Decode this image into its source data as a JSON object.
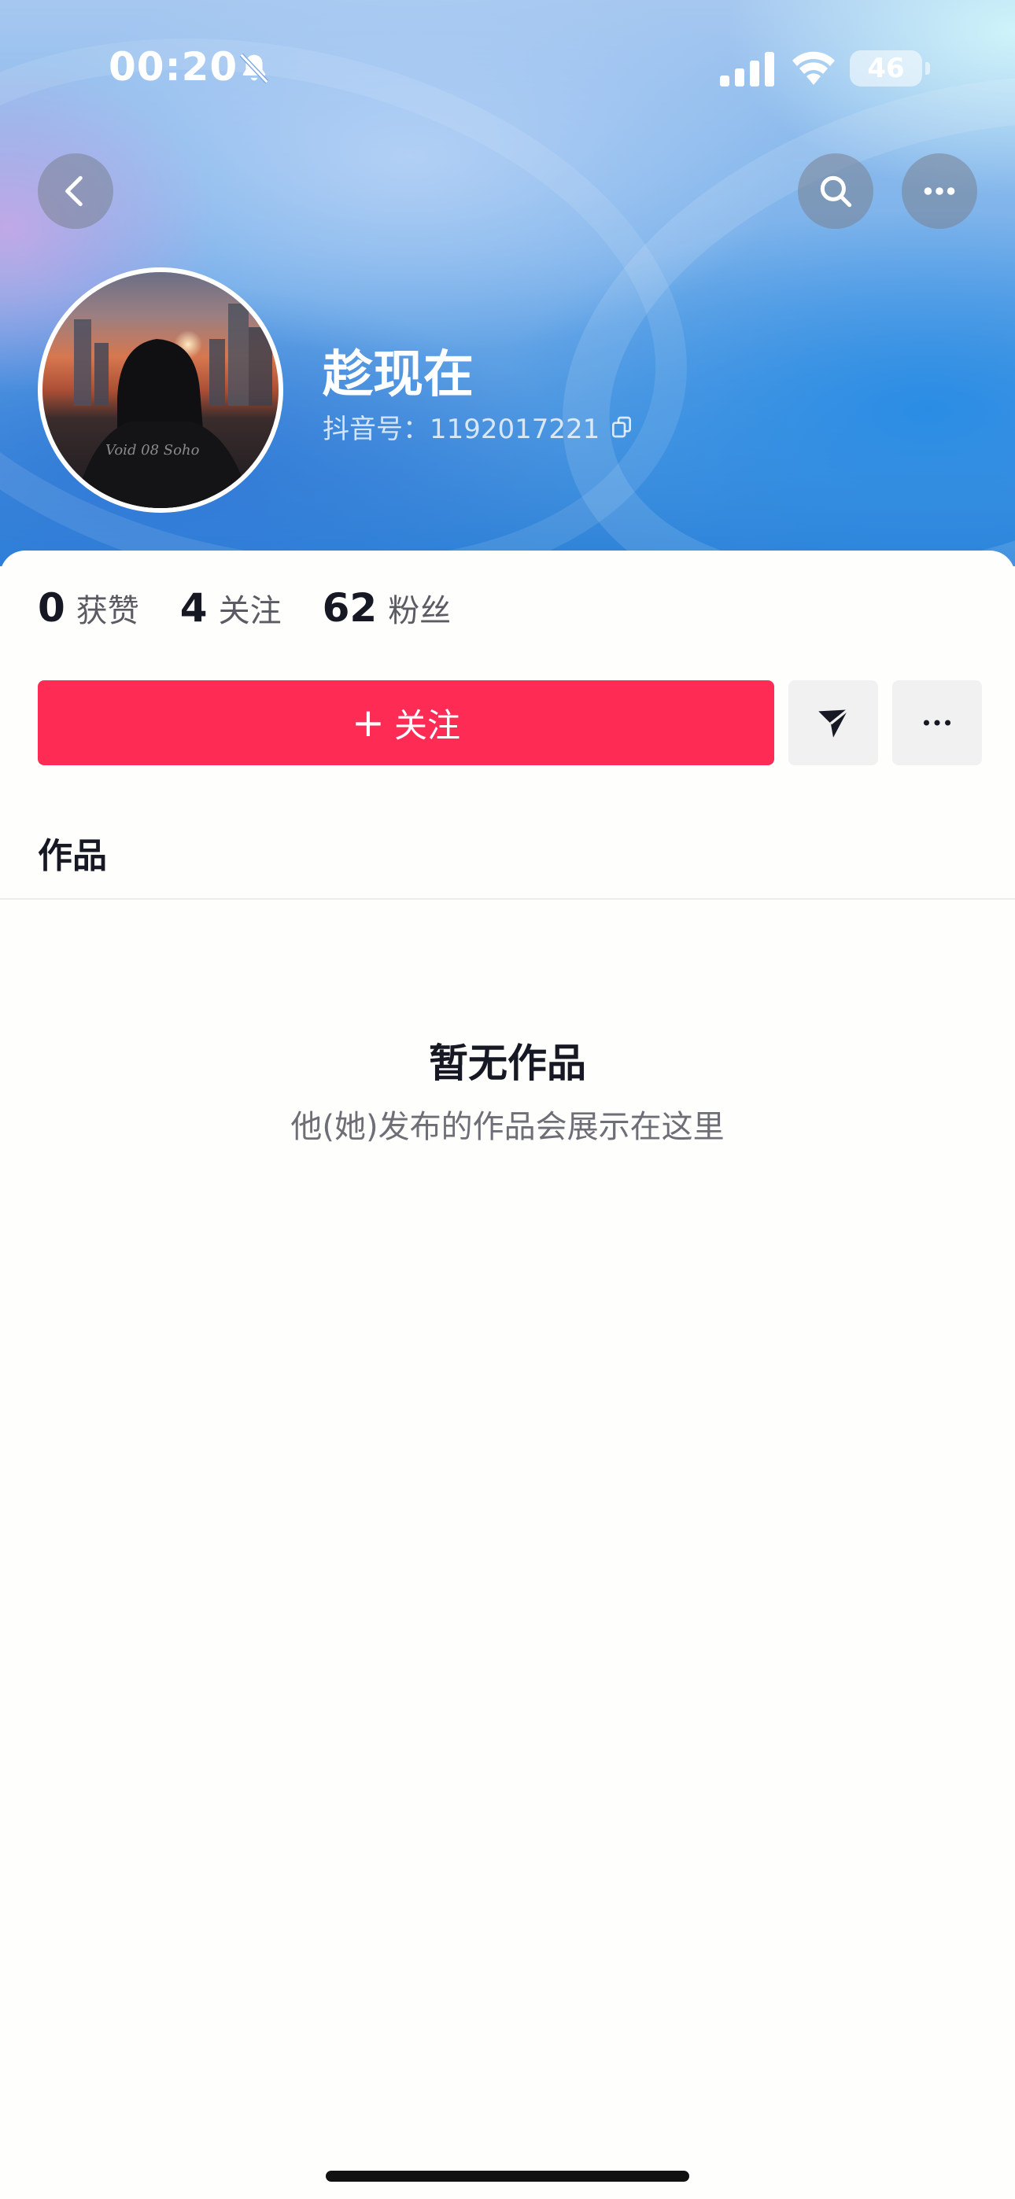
{
  "status_bar": {
    "time": "00:20",
    "battery": "46",
    "icons": [
      "bell-off-icon",
      "signal-icon",
      "wifi-icon",
      "battery-icon"
    ]
  },
  "header": {
    "icons": [
      "back-icon",
      "search-icon",
      "more-icon"
    ]
  },
  "profile": {
    "name": "趁现在",
    "douyin_id": "抖音号：1192017221"
  },
  "stats": [
    {
      "value": "0",
      "label": "获赞"
    },
    {
      "value": "4",
      "label": "关注"
    },
    {
      "value": "62",
      "label": "粉丝"
    }
  ],
  "actions": {
    "follow_label": "关注",
    "follow_icon": "+",
    "message_icon": "send-icon",
    "more_icon": "more-icon"
  },
  "tabs": {
    "works": "作品"
  },
  "empty_state": {
    "title": "暂无作品",
    "subtitle": "他(她)发布的作品会展示在这里"
  },
  "colors": {
    "accent": "#fe2c55",
    "text": "#161823",
    "secondary_button": "#f1f1f2"
  }
}
